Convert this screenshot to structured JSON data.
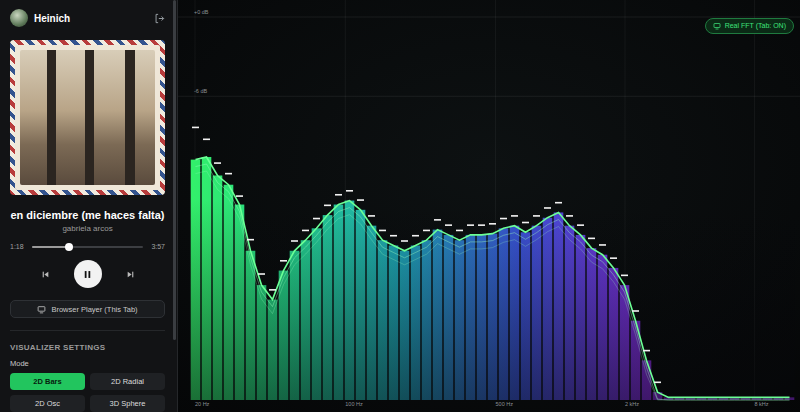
{
  "user": {
    "name": "Heinich"
  },
  "track": {
    "title": "en diciembre (me haces falta)",
    "artist": "gabriela arcos",
    "elapsed": "1:18",
    "duration": "3:57",
    "level": 0.33,
    "playing": true
  },
  "player_button": {
    "label": "Browser Player (This Tab)"
  },
  "settings": {
    "heading": "VISUALIZER SETTINGS",
    "mode_label": "Mode",
    "modes": [
      {
        "label": "2D Bars",
        "selected": true
      },
      {
        "label": "2D Radial",
        "selected": false
      },
      {
        "label": "2D Osc",
        "selected": false
      },
      {
        "label": "3D Sphere",
        "selected": false
      }
    ]
  },
  "badge": {
    "label": "Real FFT (Tab: ON)",
    "on": true
  },
  "chart": {
    "y_axis": {
      "min": -29,
      "max": 0,
      "ticks": [
        {
          "label": "+0 dB",
          "value": 0
        },
        {
          "label": "-6 dB",
          "value": -6
        }
      ]
    },
    "x_axis": {
      "ticks": [
        {
          "label": "20 Hz",
          "value": 20
        },
        {
          "label": "100 Hz",
          "value": 100
        },
        {
          "label": "500 Hz",
          "value": 500
        },
        {
          "label": "2 kHz",
          "value": 2000
        },
        {
          "label": "8 kHz",
          "value": 8000
        }
      ]
    },
    "series": [
      {
        "name": "spectrum",
        "values": [
          -10.8,
          -10.6,
          -12.0,
          -12.7,
          -14.2,
          -17.7,
          -20.3,
          -21.4,
          -19.2,
          -17.7,
          -16.9,
          -16.0,
          -15.0,
          -14.2,
          -13.9,
          -14.6,
          -15.8,
          -16.9,
          -17.3,
          -17.7,
          -17.3,
          -16.9,
          -16.1,
          -16.5,
          -16.9,
          -16.5,
          -16.5,
          -16.4,
          -16.0,
          -15.8,
          -16.3,
          -15.8,
          -15.2,
          -14.8,
          -15.8,
          -16.5,
          -17.5,
          -18.0,
          -19.0,
          -20.3,
          -23.0,
          -26.0,
          -28.4,
          -28.8,
          -28.8,
          -28.8,
          -28.8,
          -28.8,
          -28.8,
          -28.8,
          -28.8,
          -28.8,
          -28.8,
          -28.8,
          -28.8
        ]
      },
      {
        "name": "peaks",
        "values": [
          -8.3,
          -9.2,
          -11.0,
          -11.8,
          -13.5,
          -16.8,
          -19.4,
          -20.6,
          -18.4,
          -16.9,
          -16.1,
          -15.2,
          -14.2,
          -13.4,
          -13.1,
          -13.8,
          -15.0,
          -16.1,
          -16.5,
          -16.9,
          -16.5,
          -16.1,
          -15.3,
          -15.7,
          -16.1,
          -15.7,
          -15.7,
          -15.6,
          -15.2,
          -15.0,
          -15.5,
          -15.0,
          -14.4,
          -14.0,
          -15.0,
          -15.7,
          -16.7,
          -17.2,
          -18.2,
          -19.5,
          -22.2,
          -25.2,
          -27.6,
          -29,
          -29,
          -29,
          -29,
          -29,
          -29,
          -29,
          -29,
          -29,
          -29,
          -29,
          -29
        ]
      }
    ]
  }
}
